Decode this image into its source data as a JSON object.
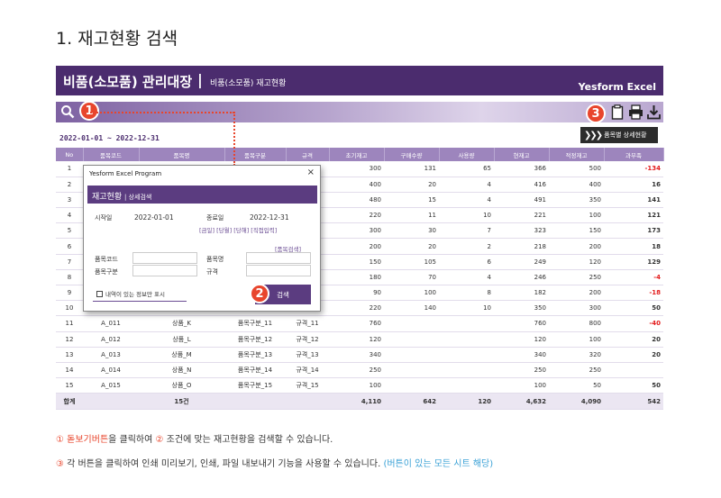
{
  "heading": "1. 재고현황 검색",
  "app": {
    "title": "비품(소모품) 관리대장",
    "separator": "|",
    "subtitle": "비품(소모품) 재고현황",
    "brand": "Yesform Excel",
    "date_range": "2022-01-01 ~ 2022-12-31",
    "detail_button": "품목별 상세현황",
    "badges": {
      "one": "1",
      "two": "2",
      "three": "3"
    },
    "columns": [
      "No",
      "품목코드",
      "품목명",
      "품목구분",
      "규격",
      "초기재고",
      "구매수량",
      "사용량",
      "현재고",
      "적정재고",
      "과부족"
    ],
    "rows": [
      [
        "1",
        "",
        "",
        "",
        "",
        "300",
        "131",
        "65",
        "366",
        "500",
        "-134"
      ],
      [
        "2",
        "",
        "",
        "",
        "",
        "400",
        "20",
        "4",
        "416",
        "400",
        "16"
      ],
      [
        "3",
        "",
        "",
        "",
        "",
        "480",
        "15",
        "4",
        "491",
        "350",
        "141"
      ],
      [
        "4",
        "",
        "",
        "",
        "",
        "220",
        "11",
        "10",
        "221",
        "100",
        "121"
      ],
      [
        "5",
        "",
        "",
        "",
        "",
        "300",
        "30",
        "7",
        "323",
        "150",
        "173"
      ],
      [
        "6",
        "",
        "",
        "",
        "",
        "200",
        "20",
        "2",
        "218",
        "200",
        "18"
      ],
      [
        "7",
        "",
        "",
        "",
        "",
        "150",
        "105",
        "6",
        "249",
        "120",
        "129"
      ],
      [
        "8",
        "",
        "",
        "",
        "",
        "180",
        "70",
        "4",
        "246",
        "250",
        "-4"
      ],
      [
        "9",
        "",
        "",
        "",
        "",
        "90",
        "100",
        "8",
        "182",
        "200",
        "-18"
      ],
      [
        "10",
        "",
        "",
        "",
        "",
        "220",
        "140",
        "10",
        "350",
        "300",
        "50"
      ],
      [
        "11",
        "A_011",
        "상품_K",
        "품목구분_11",
        "규격_11",
        "760",
        "",
        "",
        "760",
        "800",
        "-40"
      ],
      [
        "12",
        "A_012",
        "상품_L",
        "품목구분_12",
        "규격_12",
        "120",
        "",
        "",
        "120",
        "100",
        "20"
      ],
      [
        "13",
        "A_013",
        "상품_M",
        "품목구분_13",
        "규격_13",
        "340",
        "",
        "",
        "340",
        "320",
        "20"
      ],
      [
        "14",
        "A_014",
        "상품_N",
        "품목구분_14",
        "규격_14",
        "250",
        "",
        "",
        "250",
        "250",
        ""
      ],
      [
        "15",
        "A_015",
        "상품_O",
        "품목구분_15",
        "규격_15",
        "100",
        "",
        "",
        "100",
        "50",
        "50"
      ]
    ],
    "total": [
      "합계",
      "",
      "15건",
      "",
      "",
      "4,110",
      "642",
      "120",
      "4,632",
      "4,090",
      "542"
    ]
  },
  "dialog": {
    "window_title": "Yesform Excel Program",
    "close": "×",
    "header": "재고현황",
    "header_sub": "| 상세검색",
    "start_label": "시작일",
    "start_value": "2022-01-01",
    "end_label": "종료일",
    "end_value": "2022-12-31",
    "quick_links": "[금일] [당월] [당해] [직접입력]",
    "item_search_link": "[품목검색]",
    "code_label": "품목코드",
    "name_label": "품목명",
    "category_label": "품목구분",
    "spec_label": "규격",
    "checkbox_label": "내역이 있는 정보만 표시",
    "search_button": "검색"
  },
  "notes": {
    "line1_c1": "①",
    "line1_a": " 돋보기버튼",
    "line1_b": "을 클릭하여 ",
    "line1_c2": "②",
    "line1_c": " 조건에 맞는 재고현황을 검색할 수 있습니다.",
    "line2_c3": "③",
    "line2_a": " 각 버튼을 클릭하여 인쇄 미리보기, 인쇄, 파일 내보내기 기능을 사용할 수 있습니다. ",
    "line2_b": "(버튼이 있는 모든 시트 해당)"
  },
  "colors": {
    "header": "#4b2c6e",
    "accent": "#e8452c",
    "negative": "#e31b1b",
    "link": "#3aa1d6"
  }
}
